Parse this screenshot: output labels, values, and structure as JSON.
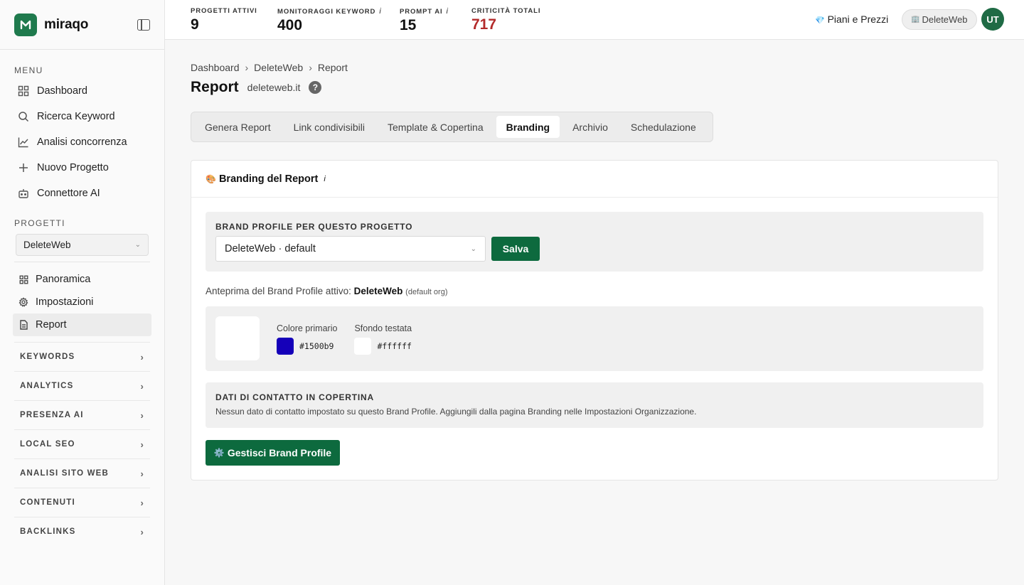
{
  "app": {
    "name": "miraqo",
    "logo_letter": "M"
  },
  "sidebar": {
    "menu_label": "MENU",
    "menu_items": [
      {
        "label": "Dashboard",
        "icon": "grid-icon"
      },
      {
        "label": "Ricerca Keyword",
        "icon": "search-icon"
      },
      {
        "label": "Analisi concorrenza",
        "icon": "chart-line-icon"
      },
      {
        "label": "Nuovo Progetto",
        "icon": "plus-icon"
      },
      {
        "label": "Connettore AI",
        "icon": "robot-icon"
      }
    ],
    "projects_label": "PROGETTI",
    "project_select": "DeleteWeb",
    "project_items": [
      {
        "label": "Panoramica",
        "icon": "grid-icon"
      },
      {
        "label": "Impostazioni",
        "icon": "gear-icon"
      },
      {
        "label": "Report",
        "icon": "document-icon",
        "active": true
      }
    ],
    "groups": [
      "KEYWORDS",
      "ANALYTICS",
      "PRESENZA AI",
      "LOCAL SEO",
      "ANALISI SITO WEB",
      "CONTENUTI",
      "BACKLINKS"
    ]
  },
  "topbar": {
    "stats": [
      {
        "label": "PROGETTI ATTIVI",
        "value": "9",
        "info": false
      },
      {
        "label": "MONITORAGGI KEYWORD",
        "value": "400",
        "info": true
      },
      {
        "label": "PROMPT AI",
        "value": "15",
        "info": true
      },
      {
        "label": "CRITICITÀ TOTALI",
        "value": "717",
        "info": false
      }
    ],
    "info_mark": "i",
    "plans_label": "Piani e Prezzi",
    "org_label": "DeleteWeb",
    "avatar_initials": "UT"
  },
  "breadcrumb": [
    "Dashboard",
    "DeleteWeb",
    "Report"
  ],
  "page": {
    "title": "Report",
    "domain": "deleteweb.it",
    "help": "?"
  },
  "tabs": [
    {
      "label": "Genera Report"
    },
    {
      "label": "Link condivisibili"
    },
    {
      "label": "Template & Copertina"
    },
    {
      "label": "Branding",
      "active": true
    },
    {
      "label": "Archivio"
    },
    {
      "label": "Schedulazione"
    }
  ],
  "branding": {
    "heading": "Branding del Report",
    "heading_emoji": "🎨",
    "info_mark": "i",
    "profile_label": "BRAND PROFILE PER QUESTO PROGETTO",
    "profile_value": "DeleteWeb · default",
    "save_label": "Salva",
    "preview_prefix": "Anteprima del Brand Profile attivo:",
    "preview_name": "DeleteWeb",
    "preview_note": "(default org)",
    "primary_label": "Colore primario",
    "primary_hex": "#1500b9",
    "header_bg_label": "Sfondo testata",
    "header_bg_hex": "#ffffff",
    "contact_title": "DATI DI CONTATTO IN COPERTINA",
    "contact_text": "Nessun dato di contatto impostato su questo Brand Profile. Aggiungili dalla pagina Branding nelle Impostazioni Organizzazione.",
    "manage_label": "Gestisci Brand Profile",
    "manage_emoji": "⚙️"
  },
  "colors": {
    "accent": "#0d6a3e",
    "critical": "#b32a2a"
  }
}
